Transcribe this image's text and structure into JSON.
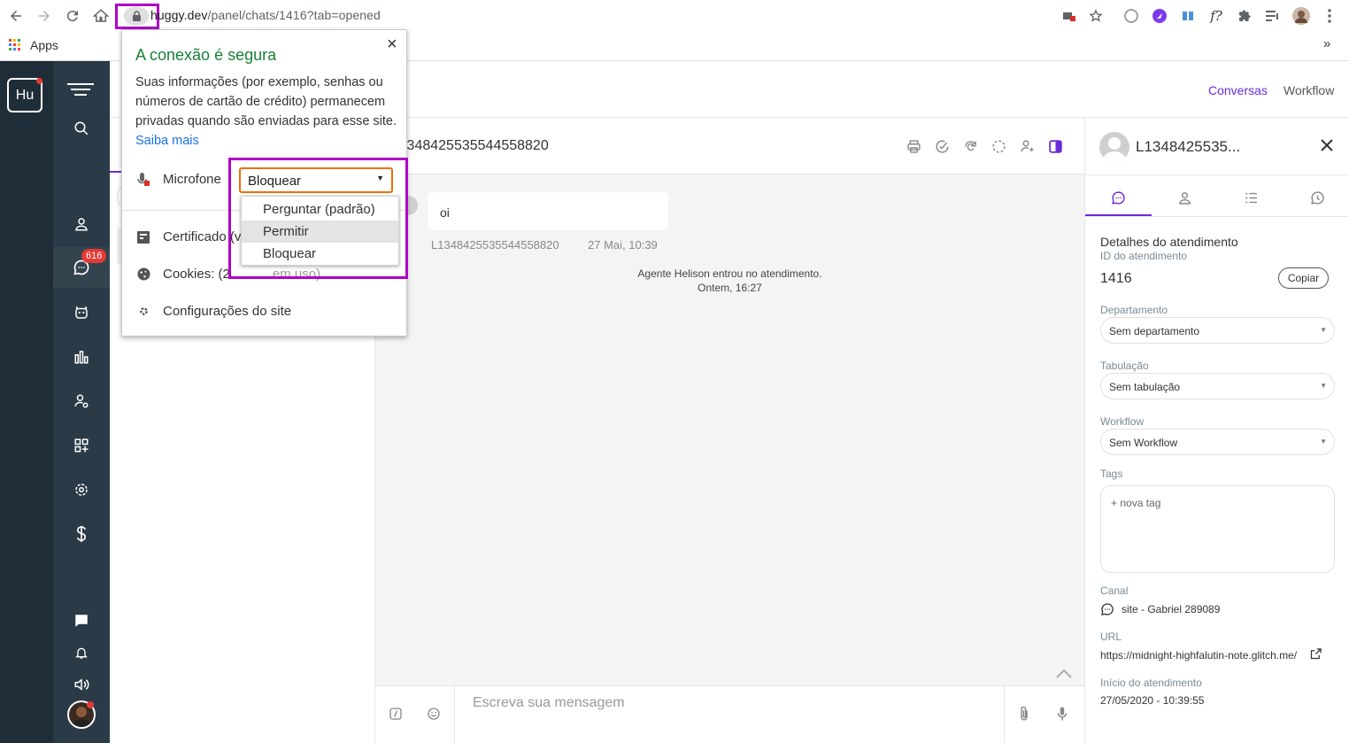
{
  "browser": {
    "url_host": "huggy.dev",
    "url_path": "/panel/chats/1416?tab=opened",
    "bookmarks": {
      "apps_label": "Apps",
      "overflow": "»"
    }
  },
  "site_info": {
    "title": "A conexão é segura",
    "description": "Suas informações (por exemplo, senhas ou números de cartão de crédito) permanecem privadas quando são enviadas para esse site.",
    "learn_more": "Saiba mais",
    "close": "×",
    "microphone_label": "Microfone",
    "microphone_value": "Bloquear",
    "microphone_options": [
      "Perguntar (padrão)",
      "Permitir",
      "Bloquear"
    ],
    "certificate_label": "Certificado (v",
    "cookies_label": "Cookies: (2",
    "cookies_tail": " em uso)",
    "site_settings_label": "Configurações do site"
  },
  "sidebar": {
    "logo": "Hu",
    "badge_count": "616"
  },
  "header": {
    "links": [
      "Conversas",
      "Workflow"
    ]
  },
  "conversation": {
    "title": "l348425535544558820",
    "message_text": "oi",
    "message_author": "L1348425535544558820",
    "message_time": "27 Mai, 10:39",
    "system_event": "Agente Helison entrou no atendimento.",
    "system_time": "Ontem, 16:27",
    "composer_placeholder": "Escreva sua mensagem"
  },
  "details": {
    "contact_name": "L1348425535...",
    "section_title": "Detalhes do atendimento",
    "id_label": "ID do atendimento",
    "id_value": "1416",
    "copy_button": "Copiar",
    "department_label": "Departamento",
    "department_value": "Sem departamento",
    "tabulation_label": "Tabulação",
    "tabulation_value": "Sem tabulação",
    "workflow_label": "Workflow",
    "workflow_value": "Sem Workflow",
    "tags_label": "Tags",
    "tags_placeholder": "+ nova tag",
    "channel_label": "Canal",
    "channel_value": "site - Gabriel 289089",
    "url_label": "URL",
    "url_value": "https://midnight-highfalutin-note.glitch.me/",
    "start_label": "Início do atendimento",
    "start_value": "27/05/2020 - 10:39:55"
  },
  "colors": {
    "accent": "#6c2bd9",
    "highlight": "#b000c8",
    "secure_green": "#188038",
    "sidebar_bg": "#2a3a46",
    "badge_red": "#e53935"
  }
}
